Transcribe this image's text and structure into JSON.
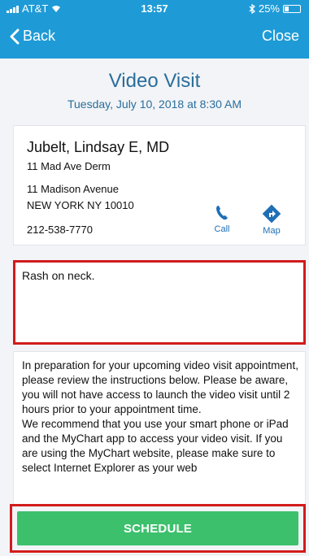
{
  "status_bar": {
    "carrier": "AT&T",
    "time": "13:57",
    "battery_text": "25%",
    "battery_level": 0.25
  },
  "nav": {
    "back_label": "Back",
    "close_label": "Close"
  },
  "header": {
    "title": "Video Visit",
    "datetime": "Tuesday, July 10, 2018 at 8:30 AM"
  },
  "provider": {
    "name": "Jubelt, Lindsay E, MD",
    "department": "11 Mad Ave Derm",
    "address_line1": "11 Madison Avenue",
    "address_line2": "NEW YORK NY 10010",
    "phone": "212-538-7770",
    "call_label": "Call",
    "map_label": "Map"
  },
  "visit": {
    "reason": "Rash on neck."
  },
  "instructions": {
    "paragraph1": "In preparation for your upcoming video visit appointment, please review the instructions below. Please be aware, you will not have access to launch the video visit until 2 hours prior to your appointment time.",
    "paragraph2": "We recommend that you use your smart phone or iPad and the MyChart app to access your video visit. If you are using the MyChart website, please make sure to select Internet Explorer as your web"
  },
  "actions": {
    "schedule_label": "SCHEDULE"
  },
  "colors": {
    "brand_blue": "#1e9bd7",
    "title_blue": "#2a6d9c",
    "action_blue": "#1e6fb6",
    "schedule_green": "#3cc06c",
    "highlight_red": "#d21b1b"
  }
}
